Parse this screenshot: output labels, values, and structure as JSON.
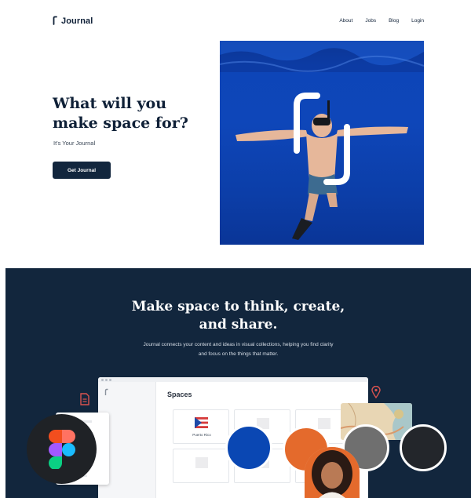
{
  "header": {
    "brand": "Journal",
    "nav": [
      "About",
      "Jobs",
      "Blog",
      "Login"
    ]
  },
  "hero": {
    "title_line1": "What will you",
    "title_line2": "make space for?",
    "subtitle": "It's Your Journal",
    "cta_label": "Get Journal",
    "image_subject": "snorkeler-underwater-with-journal-logo"
  },
  "section": {
    "title_line1": "Make space to think, create,",
    "title_line2": "and share.",
    "description": "Journal connects your content and ideas in visual collections, helping you find clarity and focus on the things that matter."
  },
  "app_preview": {
    "heading": "Spaces",
    "card_label": "Puerto Rico"
  },
  "swatches": [
    "#0a47b3",
    "#e46a2c",
    "#6f6f6f",
    "#23262b"
  ],
  "colors": {
    "navy": "#12263d",
    "accent_red": "#d9534f",
    "ocean_blue": "#0e46b9"
  },
  "icons": [
    "document-icon",
    "location-pin-icon",
    "figma-logo-icon",
    "journal-logo-icon"
  ]
}
